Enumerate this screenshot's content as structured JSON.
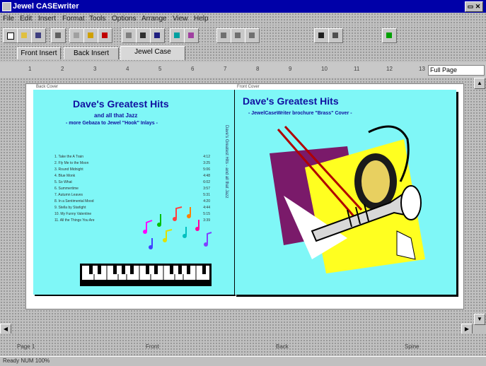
{
  "window": {
    "title": "Jewel CASEwriter"
  },
  "menu": [
    "File",
    "Edit",
    "Insert",
    "Format",
    "Tools",
    "Options",
    "Arrange",
    "View",
    "Help"
  ],
  "toolbar": {
    "buttons": [
      "new-icon",
      "open-icon",
      "save-icon",
      "print-icon",
      "cut-icon",
      "copy-icon",
      "paste-icon",
      "undo-icon",
      "text-icon",
      "line-icon",
      "box-icon",
      "picture-icon",
      "align-left-icon",
      "align-center-icon",
      "align-right-icon",
      "bold-icon",
      "italic-icon",
      "color-icon"
    ],
    "colors": {
      "accent_blue": "#0000a8",
      "face": "#c0c0c0"
    }
  },
  "tabs": [
    {
      "label": "Front Insert",
      "active": false
    },
    {
      "label": "Back Insert",
      "active": false
    },
    {
      "label": "Jewel Case",
      "active": true
    }
  ],
  "ruler": {
    "ticks": [
      "1",
      "2",
      "3",
      "4",
      "5",
      "6",
      "7",
      "8",
      "9",
      "10",
      "11",
      "12",
      "13"
    ],
    "zoom": "Full Page"
  },
  "document": {
    "back_label": "Back Cover",
    "front_label": "Front Cover",
    "back": {
      "title": "Dave's Greatest Hits",
      "sub1": "and all that Jazz",
      "sub2": "- more Gebaza to Jewel \"Hook\" Inlays -",
      "tracks": [
        {
          "title": "1. Take the A Train",
          "time": "4:12"
        },
        {
          "title": "2. Fly Me to the Moon",
          "time": "3:25"
        },
        {
          "title": "3. Round Midnight",
          "time": "5:06"
        },
        {
          "title": "4. Blue Monk",
          "time": "4:48"
        },
        {
          "title": "5. So What",
          "time": "6:02"
        },
        {
          "title": "6. Summertime",
          "time": "3:57"
        },
        {
          "title": "7. Autumn Leaves",
          "time": "5:31"
        },
        {
          "title": "8. In a Sentimental Mood",
          "time": "4:20"
        },
        {
          "title": "9. Stella by Starlight",
          "time": "4:44"
        },
        {
          "title": "10. My Funny Valentine",
          "time": "5:15"
        },
        {
          "title": "11. All the Things You Are",
          "time": "3:39"
        }
      ],
      "spine": "Dave's Greatest Hits - and all that Jazz"
    },
    "front": {
      "title": "Dave's Greatest Hits",
      "subtitle": "- JewelCaseWriter brochure \"Brass\" Cover -"
    },
    "colors": {
      "panel": "#7ff7f7",
      "title": "#1010a0",
      "burgundy": "#7a1a6a",
      "yellow": "#ffff20"
    }
  },
  "bottom": {
    "cells": [
      "Page 1",
      "Front",
      "Back",
      "Spine"
    ]
  },
  "status": "Ready   NUM   100%"
}
